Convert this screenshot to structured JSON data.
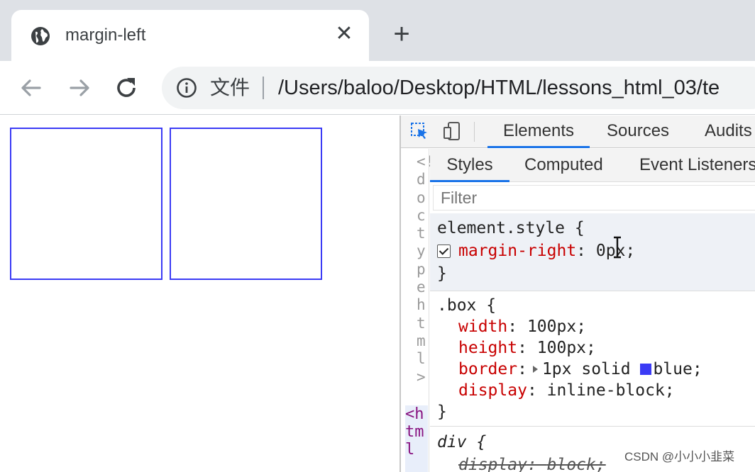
{
  "browser": {
    "tab": {
      "title": "margin-left",
      "close_glyph": "✕",
      "favicon": "globe-icon"
    },
    "new_tab_glyph": "+",
    "toolbar": {
      "back_icon": "arrow-left-icon",
      "forward_icon": "arrow-right-icon",
      "reload_icon": "reload-icon",
      "info_icon": "info-icon",
      "chip_label": "文件",
      "url": "/Users/baloo/Desktop/HTML/lessons_html_03/te"
    }
  },
  "devtools": {
    "tabs": [
      "Elements",
      "Sources",
      "Audits"
    ],
    "active_tab": "Elements",
    "subtabs": [
      "Styles",
      "Computed",
      "Event Listeners"
    ],
    "active_subtab": "Styles",
    "filter_placeholder": "Filter",
    "gutter": {
      "doctype": "<!doctype html>",
      "html": "<html"
    },
    "rules": {
      "element_style": {
        "selector": "element.style {",
        "decl": {
          "prop": "margin-right",
          "value": "0px;",
          "checked": true
        },
        "close": "}"
      },
      "box": {
        "selector": ".box {",
        "decls": [
          {
            "prop": "width",
            "value": "100px;"
          },
          {
            "prop": "height",
            "value": "100px;"
          },
          {
            "prop": "border",
            "value": "1px solid",
            "color_word": "blue;",
            "swatch": "#3b3bf5"
          },
          {
            "prop": "display",
            "value": "inline-block;"
          }
        ],
        "close": "}"
      },
      "div": {
        "selector": "div {",
        "decl": {
          "prop": "display",
          "value": "block;"
        }
      }
    }
  },
  "watermark": "CSDN @小小小韭菜",
  "colors": {
    "box_border": "#3b3bf5",
    "accent": "#1a73e8",
    "property": "#c80000"
  }
}
